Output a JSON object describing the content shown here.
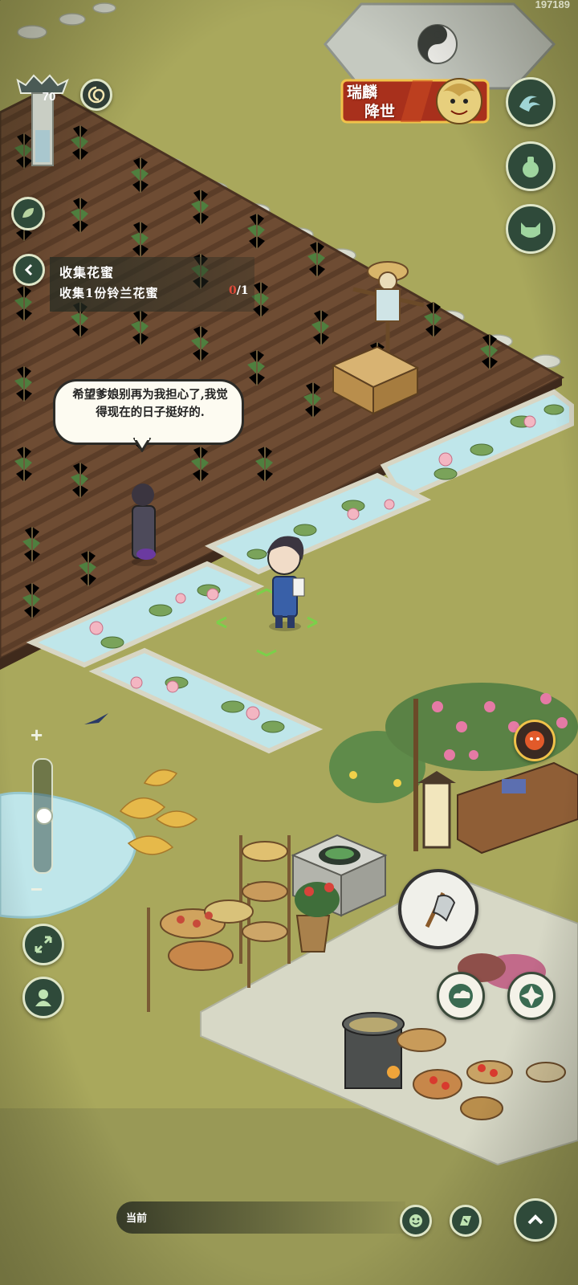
{
  "hud": {
    "score": "197189",
    "player_level": "70"
  },
  "event": {
    "line1": "瑞麟",
    "line2": "降世"
  },
  "quest": {
    "title": "收集花蜜",
    "description": "收集1份铃兰花蜜",
    "progress_current": "0",
    "progress_total": "/1"
  },
  "dialogue": {
    "text": "希望爹娘别再为我担心了,我觉得现在的日子挺好的."
  },
  "zoom": {
    "plus": "+",
    "minus": "−",
    "level": 0.5
  },
  "chat": {
    "channel_label": "当前"
  },
  "colors": {
    "grass": "#a9a85c",
    "soil": "#6b4a32",
    "water": "#bfe6ea",
    "ui_dark": "#2f4a3a",
    "ui_border": "#dfe6c8",
    "progress_red": "#e04a3a"
  }
}
